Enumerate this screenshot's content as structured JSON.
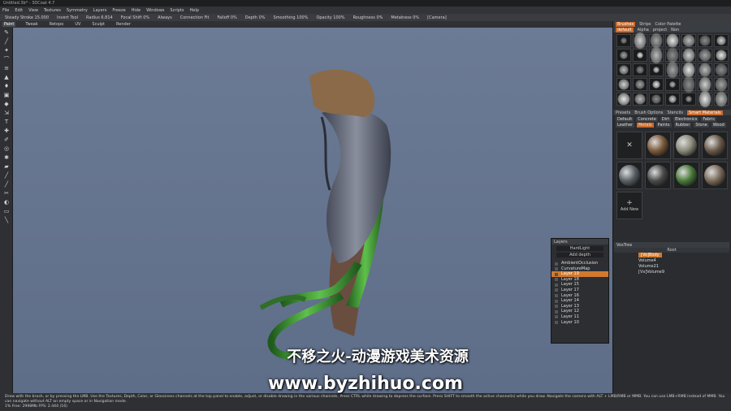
{
  "window": {
    "title": "Untitled.3b* - 3DCoat 4.7"
  },
  "menu": [
    "File",
    "Edit",
    "View",
    "Textures",
    "Symmetry",
    "Layers",
    "Freeze",
    "Hide",
    "Windows",
    "Scripts",
    "Help"
  ],
  "tool_options": [
    {
      "label": "Steady Stroke",
      "value": "15.000"
    },
    {
      "label": "Invert Tool",
      "value": ""
    },
    {
      "label": "Radius",
      "value": "6.814"
    },
    {
      "label": "Focal Shift",
      "value": "0%"
    },
    {
      "label": "Falloff",
      "value": "0%"
    },
    {
      "label": "Depth",
      "value": "0%"
    },
    {
      "label": "Smoothing",
      "value": "100%"
    },
    {
      "label": "Opacity",
      "value": "100%"
    },
    {
      "label": "Roughness",
      "value": "0%"
    },
    {
      "label": "Metalness",
      "value": "0%"
    }
  ],
  "mode_always": "Always",
  "connection_label": "Connection Fit",
  "camera_label": "[Camera]",
  "modes": [
    "Paint",
    "Tweak",
    "Retopo",
    "UV",
    "Sculpt",
    "Render"
  ],
  "right_tabs": [
    "Brushes",
    "Strips",
    "Color Palette"
  ],
  "brush_subtabs": [
    "default",
    "Alpha",
    "project",
    "Non"
  ],
  "mid_tabs": [
    "Presets",
    "Brush Options",
    "Stencils",
    "Smart Materials"
  ],
  "material_chips": [
    "Default",
    "Concrete",
    "Dirt",
    "Electronics",
    "Fabric",
    "Leather",
    "Metals",
    "Paints",
    "Rubber",
    "Stone",
    "Wood"
  ],
  "material_new_label": "Add New",
  "layers_panel": {
    "title": "Layers",
    "blend": "HardLight",
    "depth": "Add depth",
    "items": [
      "AmbientOcclusion",
      "CurvatureMap",
      "Layer 19",
      "Layer 18",
      "Layer 15",
      "Layer 17",
      "Layer 16",
      "Layer 14",
      "Layer 13",
      "Layer 12",
      "Layer 11",
      "Layer 10"
    ],
    "selected_index": 2
  },
  "vox_panel": {
    "title": "VoxTree",
    "header": "Root",
    "items": [
      "[Vo]Body",
      "Volume4",
      "Volume21",
      "[Vx]Volume9"
    ],
    "selected_index": 0
  },
  "status_text": "Draw with the brush, or by pressing the LMB. Use the Textures, Depth, Color, or Glossiness channels at the top panel to enable, adjust, or disable drawing in the various channels. Press CTRL while drawing to depress the surface. Press SHIFT to smooth the active channel(s) while you draw. Navigate the camera with ALT + LMB/RMB or MMB. You can use LMB+RMB instead of MMB. You can navigate without ALT on empty space or in Navigation mode.",
  "status_line2": "1% Free: 2998Mb FPS: 2.444 (16)",
  "watermark_cn": "不移之火-动漫游戏美术资源",
  "watermark_url": "www.byzhihuo.com"
}
